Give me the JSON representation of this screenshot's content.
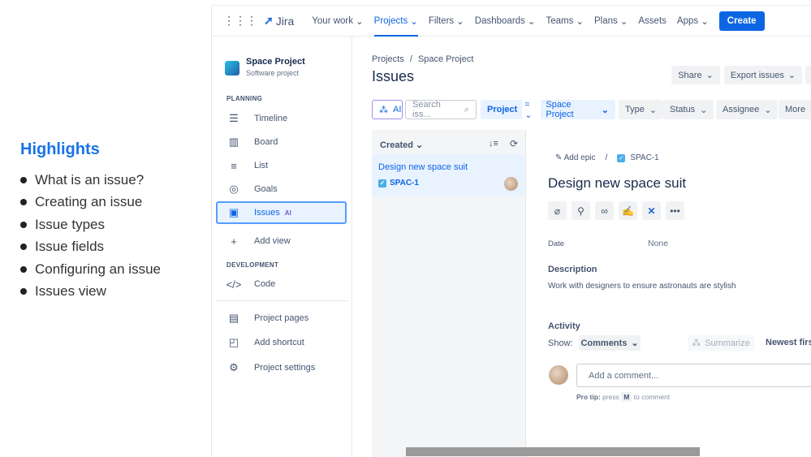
{
  "highlights": {
    "title": "Highlights",
    "items": [
      "What is an issue?",
      "Creating an issue",
      "Issue types",
      "Issue fields",
      "Configuring an issue",
      "Issues view"
    ]
  },
  "nav": {
    "logo": "Jira",
    "items": [
      "Your work",
      "Projects",
      "Filters",
      "Dashboards",
      "Teams",
      "Plans",
      "Assets",
      "Apps"
    ],
    "create": "Create"
  },
  "sidebar": {
    "project_name": "Space Project",
    "project_type": "Software project",
    "planning": "PLANNING",
    "development": "DEVELOPMENT",
    "items": [
      "Timeline",
      "Board",
      "List",
      "Goals",
      "Issues",
      "Add view",
      "Code",
      "Project pages",
      "Add shortcut",
      "Project settings"
    ],
    "ai_badge": "AI"
  },
  "main": {
    "breadcrumb_root": "Projects",
    "breadcrumb_sep": "/",
    "breadcrumb_project": "Space Project",
    "title": "Issues",
    "share": "Share",
    "export": "Export issues"
  },
  "filters": {
    "ai": "AI",
    "search_placeholder": "Search iss...",
    "project_label": "Project",
    "operator": "=",
    "project_value": "Space Project",
    "type": "Type",
    "status": "Status",
    "assignee": "Assignee",
    "more": "More"
  },
  "list": {
    "sort": "Created",
    "items": [
      {
        "title": "Design new space suit",
        "key": "SPAC-1"
      }
    ]
  },
  "detail": {
    "add_epic": "Add epic",
    "sep": "/",
    "key": "SPAC-1",
    "title": "Design new space suit",
    "date_label": "Date",
    "date_value": "None",
    "description_label": "Description",
    "description": "Work with designers to ensure astronauts are stylish",
    "activity_label": "Activity",
    "show_label": "Show:",
    "show_value": "Comments",
    "summarize": "Summarize",
    "order": "Newest first",
    "comment_placeholder": "Add a comment...",
    "pro_tip_bold": "Pro tip:",
    "pro_tip_press": "press",
    "pro_tip_key": "M",
    "pro_tip_end": "to comment"
  },
  "colors": {
    "accent": "#0c66e4",
    "highlight_title": "#1a73e8"
  }
}
